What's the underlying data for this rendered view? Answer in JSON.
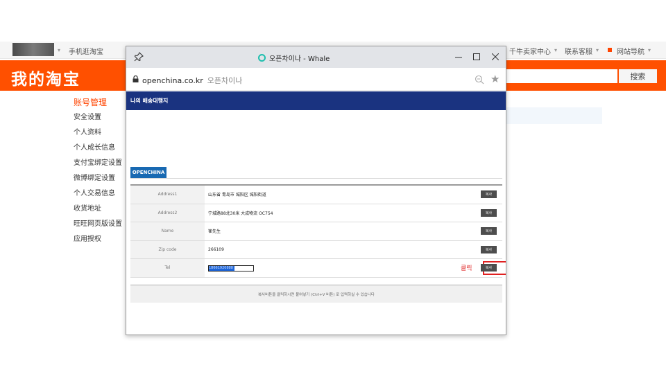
{
  "taobao": {
    "top_links": {
      "mobile": "手机逛淘宝",
      "seller_center": "千牛卖家中心",
      "customer_service": "联系客服",
      "site_nav": "网站导航"
    },
    "logo": "我的淘宝",
    "search_button": "搜索",
    "sidebar": {
      "title": "账号管理",
      "items": [
        "安全设置",
        "个人资料",
        "个人成长信息",
        "支付宝绑定设置",
        "微博绑定设置",
        "个人交易信息",
        "收货地址",
        "旺旺网页版设置",
        "应用授权"
      ]
    }
  },
  "window": {
    "title": "오픈차이나 - Whale",
    "url": "openchina.co.kr",
    "site_name": "오픈차이나",
    "header": "나의 배송대행지",
    "tab": "OPENCHINA",
    "rows": [
      {
        "label": "Address1",
        "value": "山东省 青岛市 城阳区 城阳街道",
        "button": "복사"
      },
      {
        "label": "Address2",
        "value": "宁城路88北30米  大成物流 OC754",
        "button": "복사"
      },
      {
        "label": "Name",
        "value": "崔先生",
        "button": "복사"
      },
      {
        "label": "Zip code",
        "value": "266109",
        "button": "복사"
      },
      {
        "label": "Tel",
        "value": "18661920888",
        "button": "복사"
      }
    ],
    "click_note": "클릭",
    "footer_note": "복사버튼을 클릭하시면 붙여넣기 (Ctrl+V 버튼) 로 입력하실 수 있습니다"
  },
  "colors": {
    "taobao_orange": "#ff5000",
    "header_navy": "#1a3380",
    "tab_blue": "#1869b2",
    "highlight_red": "#e02020"
  }
}
